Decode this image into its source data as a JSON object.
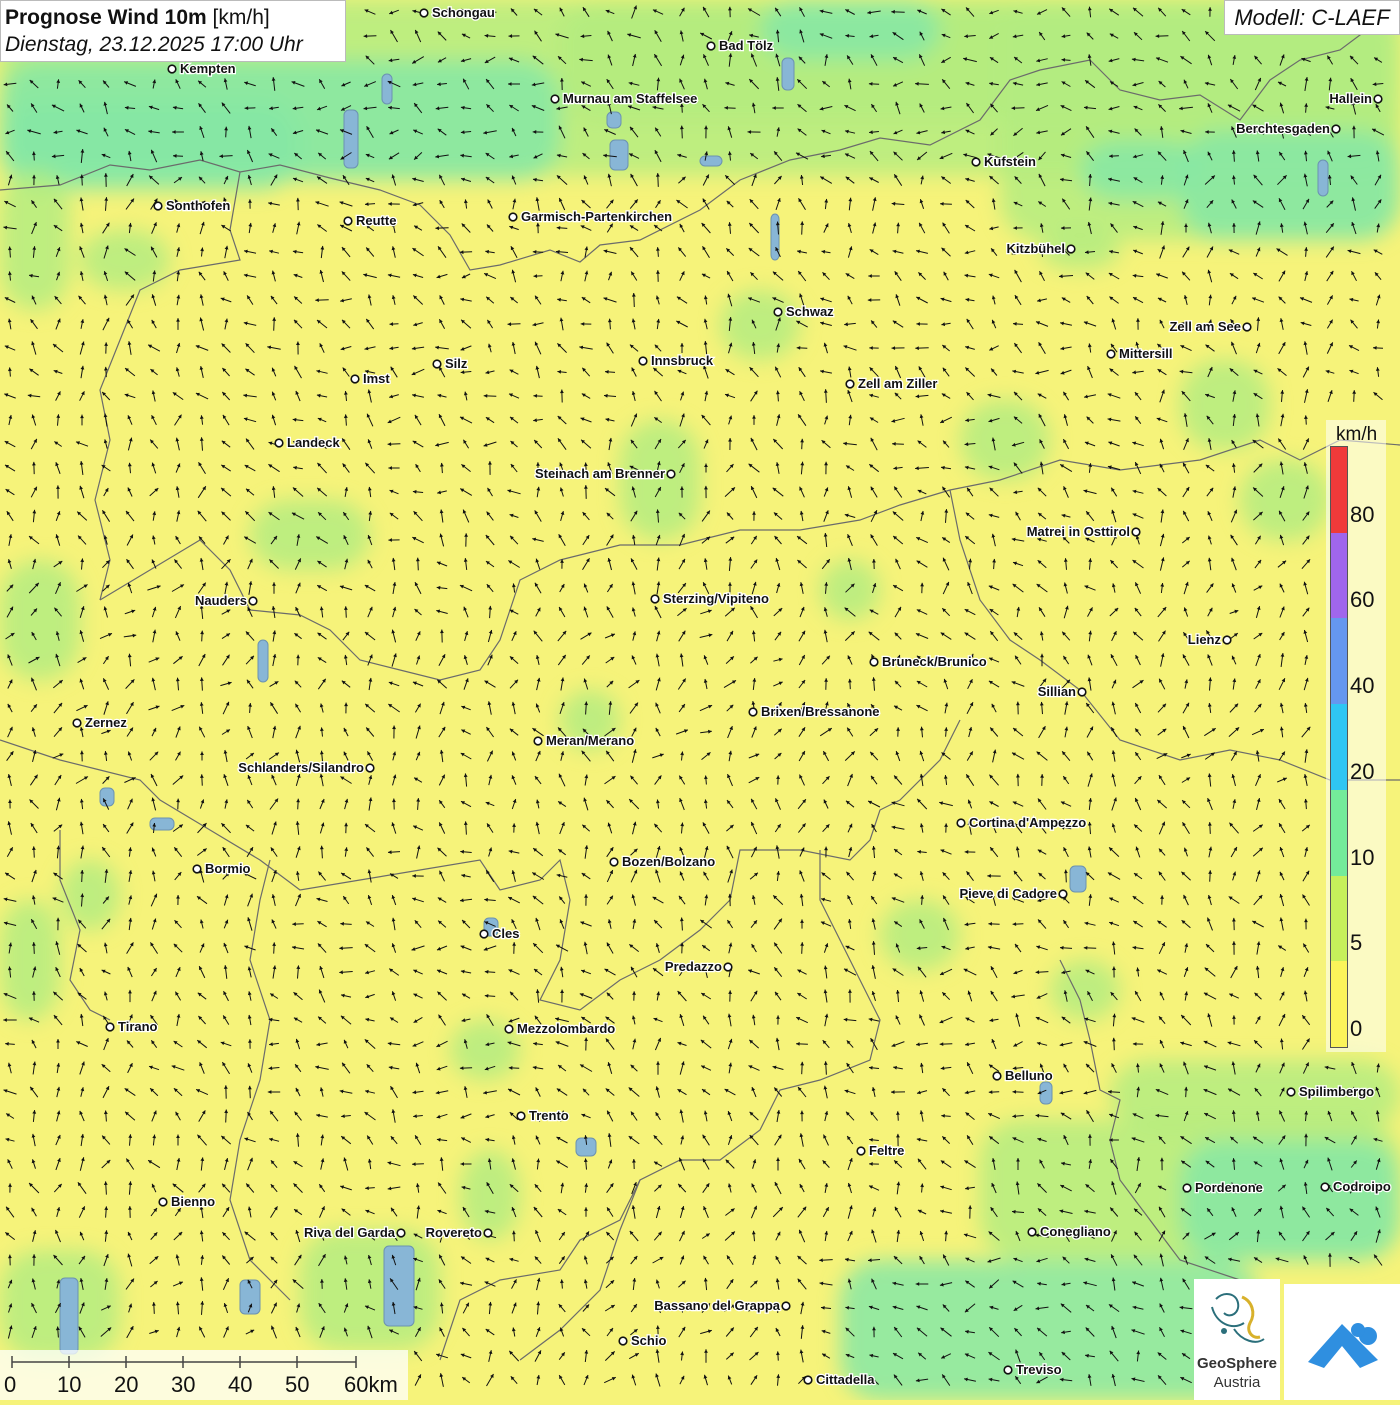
{
  "title": {
    "main": "Prognose Wind 10m",
    "unit": "[km/h]",
    "datetime": "Dienstag, 23.12.2025 17:00 Uhr"
  },
  "model_label": "Modell: C-LAEF",
  "legend": {
    "unit": "km/h",
    "ticks": [
      "0",
      "5",
      "10",
      "20",
      "40",
      "60",
      "80"
    ],
    "colors": [
      "#fbf45a",
      "#c6f05b",
      "#74eb9a",
      "#2fc6f3",
      "#6597ef",
      "#a066ec",
      "#ef3a3a"
    ]
  },
  "map_colors": {
    "base": "#f6f37a",
    "calm_green": "#b4ec80",
    "breezy_green": "#86e8a6",
    "border": "#6b6b6b",
    "lake": "#88b6d6"
  },
  "scale": {
    "ticks": [
      "0",
      "10",
      "20",
      "30",
      "40",
      "50",
      "60km"
    ]
  },
  "logos": {
    "geosphere_line1": "GeoSphere",
    "geosphere_line2": "Austria"
  },
  "cities": [
    {
      "name": "Schongau",
      "label_side": "right"
    },
    {
      "name": "Kempten",
      "label_side": "right"
    },
    {
      "name": "Bad Tölz",
      "label_side": "right"
    },
    {
      "name": "Murnau am Staffelsee",
      "label_side": "right"
    },
    {
      "name": "Hallein",
      "label_side": "left"
    },
    {
      "name": "Berchtesgaden",
      "label_side": "left"
    },
    {
      "name": "Kufstein",
      "label_side": "right"
    },
    {
      "name": "Sonthofen",
      "label_side": "right"
    },
    {
      "name": "Reutte",
      "label_side": "right"
    },
    {
      "name": "Garmisch-Partenkirchen",
      "label_side": "right"
    },
    {
      "name": "Kitzbühel",
      "label_side": "left"
    },
    {
      "name": "Schwaz",
      "label_side": "right"
    },
    {
      "name": "Zell am See",
      "label_side": "left"
    },
    {
      "name": "Mittersill",
      "label_side": "right"
    },
    {
      "name": "Innsbruck",
      "label_side": "right"
    },
    {
      "name": "Silz",
      "label_side": "right"
    },
    {
      "name": "Imst",
      "label_side": "right"
    },
    {
      "name": "Zell am Ziller",
      "label_side": "right"
    },
    {
      "name": "Landeck",
      "label_side": "right"
    },
    {
      "name": "Steinach am Brenner",
      "label_side": "left"
    },
    {
      "name": "Matrei in Osttirol",
      "label_side": "left"
    },
    {
      "name": "Nauders",
      "label_side": "left"
    },
    {
      "name": "Sterzing/Vipiteno",
      "label_side": "right"
    },
    {
      "name": "Lienz",
      "label_side": "left"
    },
    {
      "name": "Bruneck/Brunico",
      "label_side": "right"
    },
    {
      "name": "Sillian",
      "label_side": "left"
    },
    {
      "name": "Brixen/Bressanone",
      "label_side": "right"
    },
    {
      "name": "Zernez",
      "label_side": "right"
    },
    {
      "name": "Meran/Merano",
      "label_side": "right"
    },
    {
      "name": "Schlanders/Silandro",
      "label_side": "left"
    },
    {
      "name": "Cortina d'Ampezzo",
      "label_side": "right"
    },
    {
      "name": "Bozen/Bolzano",
      "label_side": "right"
    },
    {
      "name": "Bormio",
      "label_side": "right"
    },
    {
      "name": "Pieve di Cadore",
      "label_side": "left"
    },
    {
      "name": "Cles",
      "label_side": "right"
    },
    {
      "name": "Predazzo",
      "label_side": "left"
    },
    {
      "name": "Tirano",
      "label_side": "right"
    },
    {
      "name": "Mezzolombardo",
      "label_side": "right"
    },
    {
      "name": "Belluno",
      "label_side": "right"
    },
    {
      "name": "Spilimbergo",
      "label_side": "right"
    },
    {
      "name": "Trento",
      "label_side": "right"
    },
    {
      "name": "Feltre",
      "label_side": "right"
    },
    {
      "name": "Pordenone",
      "label_side": "right"
    },
    {
      "name": "Codroipo",
      "label_side": "right"
    },
    {
      "name": "Bienno",
      "label_side": "right"
    },
    {
      "name": "Riva del Garda",
      "label_side": "left"
    },
    {
      "name": "Rovereto",
      "label_side": "left"
    },
    {
      "name": "Conegliano",
      "label_side": "right"
    },
    {
      "name": "Bassano del Grappa",
      "label_side": "left"
    },
    {
      "name": "Schio",
      "label_side": "right"
    },
    {
      "name": "Treviso",
      "label_side": "right"
    },
    {
      "name": "Cittadella",
      "label_side": "right"
    }
  ]
}
